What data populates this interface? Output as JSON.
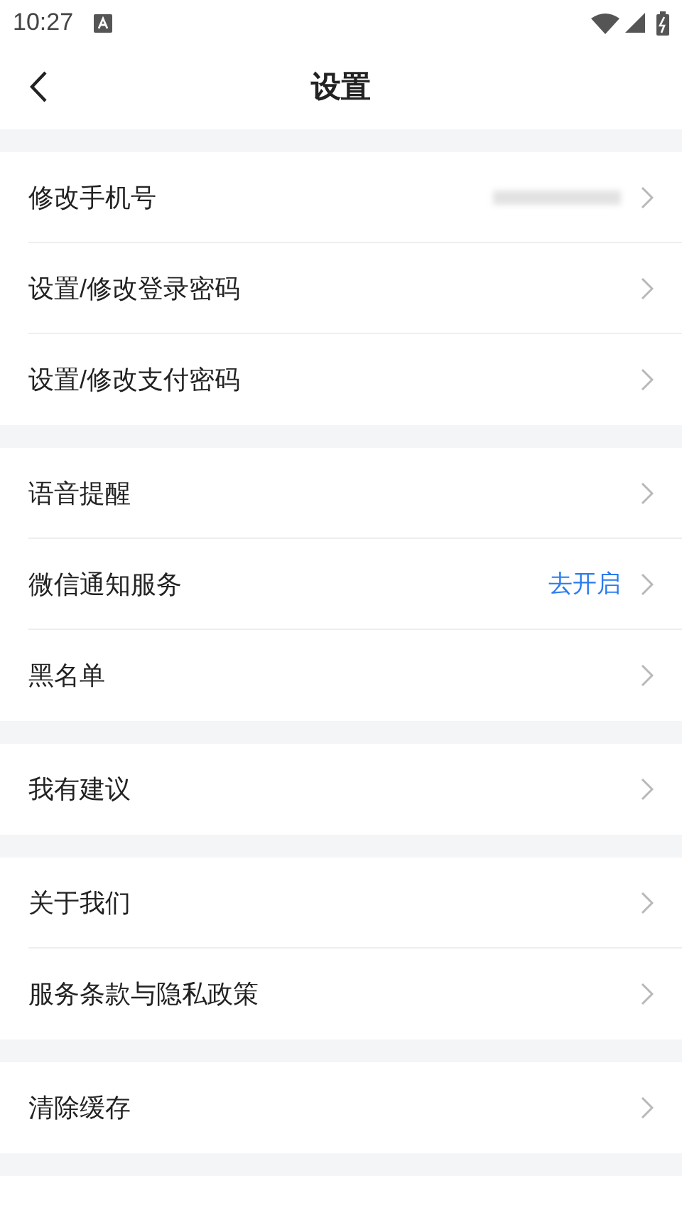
{
  "status_bar": {
    "time": "10:27"
  },
  "header": {
    "title": "设置"
  },
  "groups": [
    {
      "items": [
        {
          "label": "修改手机号",
          "kind": "masked"
        },
        {
          "label": "设置/修改登录密码",
          "kind": "plain"
        },
        {
          "label": "设置/修改支付密码",
          "kind": "plain"
        }
      ]
    },
    {
      "items": [
        {
          "label": "语音提醒",
          "kind": "plain"
        },
        {
          "label": "微信通知服务",
          "kind": "link",
          "value": "去开启"
        },
        {
          "label": "黑名单",
          "kind": "plain"
        }
      ]
    },
    {
      "items": [
        {
          "label": "我有建议",
          "kind": "plain"
        }
      ]
    },
    {
      "items": [
        {
          "label": "关于我们",
          "kind": "plain"
        },
        {
          "label": "服务条款与隐私政策",
          "kind": "plain"
        }
      ]
    },
    {
      "items": [
        {
          "label": "清除缓存",
          "kind": "plain"
        }
      ]
    }
  ]
}
